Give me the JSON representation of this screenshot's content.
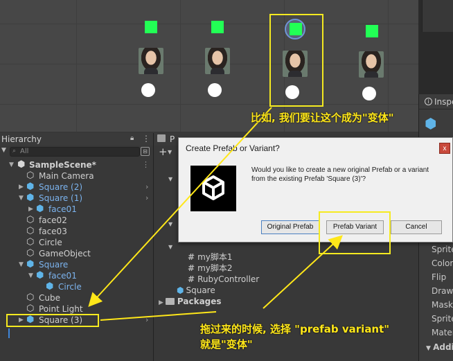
{
  "hierarchy": {
    "title": "Hierarchy",
    "search_placeholder": "All",
    "items": [
      {
        "label": "SampleScene*"
      },
      {
        "label": "Main Camera"
      },
      {
        "label": "Square (2)"
      },
      {
        "label": "Square (1)"
      },
      {
        "label": "face01"
      },
      {
        "label": "face02"
      },
      {
        "label": "face03"
      },
      {
        "label": "Circle"
      },
      {
        "label": "GameObject"
      },
      {
        "label": "Square"
      },
      {
        "label": "face01"
      },
      {
        "label": "Circle"
      },
      {
        "label": "Cube"
      },
      {
        "label": "Point Light"
      },
      {
        "label": "Square (3)"
      }
    ]
  },
  "project": {
    "tab_label": "P",
    "items": [
      {
        "label": "my脚本1"
      },
      {
        "label": "my脚本2"
      },
      {
        "label": "RubyController"
      },
      {
        "label": "Square"
      },
      {
        "label": "Packages"
      }
    ]
  },
  "inspector": {
    "tab_label": "Inspe",
    "components": [
      "Sprite",
      "Color",
      "Flip",
      "Draw",
      "Mask",
      "Sprite",
      "Mater",
      "Addit"
    ]
  },
  "dialog": {
    "title": "Create Prefab or Variant?",
    "close_label": "x",
    "message": "Would you like to create a new original Prefab or a variant from the existing Prefab 'Square (3)'?",
    "buttons": {
      "original": "Original Prefab",
      "variant": "Prefab Variant",
      "cancel": "Cancel"
    }
  },
  "annotations": {
    "top": "比如, 我们要让这个成为\"变体\"",
    "bottom_line1": "拖过来的时候, 选择 \"prefab variant\"",
    "bottom_line2": "就是\"变体\""
  },
  "colors": {
    "annotation": "#ffe719",
    "prefab_blue": "#7cb4ef",
    "scene_green": "#22ff55"
  }
}
